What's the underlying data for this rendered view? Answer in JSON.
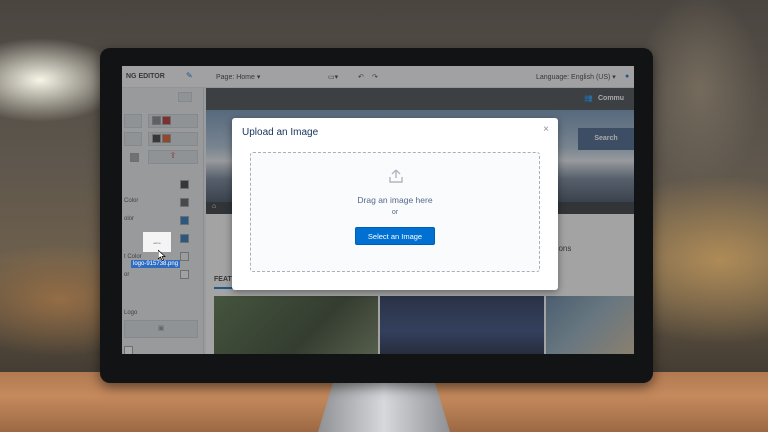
{
  "app": {
    "editor_title": "NG EDITOR",
    "page_label": "Page: Home ▾",
    "language_label": "Language: English (US) ▾",
    "community_label": "Commu"
  },
  "sidebar": {
    "labels": {
      "color": "Color",
      "olor": "olor",
      "text_color": "t Color",
      "or": "or",
      "logo": "Logo"
    },
    "swatch_colors": [
      "#7b7f84",
      "#b3262b",
      "#333333",
      "#555555",
      "#1e6fb8",
      "#1e6fb8"
    ]
  },
  "canvas": {
    "search_button": "Search",
    "questions_text": "estions",
    "featured_label": "FEAT"
  },
  "modal": {
    "title": "Upload an Image",
    "close": "×",
    "drag_text": "Drag an image here",
    "or_text": "or",
    "select_button": "Select an Image"
  },
  "drag": {
    "file_label": "logo-915738.png",
    "thumb_text": "acme"
  },
  "colors": {
    "accent": "#0070d2",
    "header": "#3e4448"
  }
}
